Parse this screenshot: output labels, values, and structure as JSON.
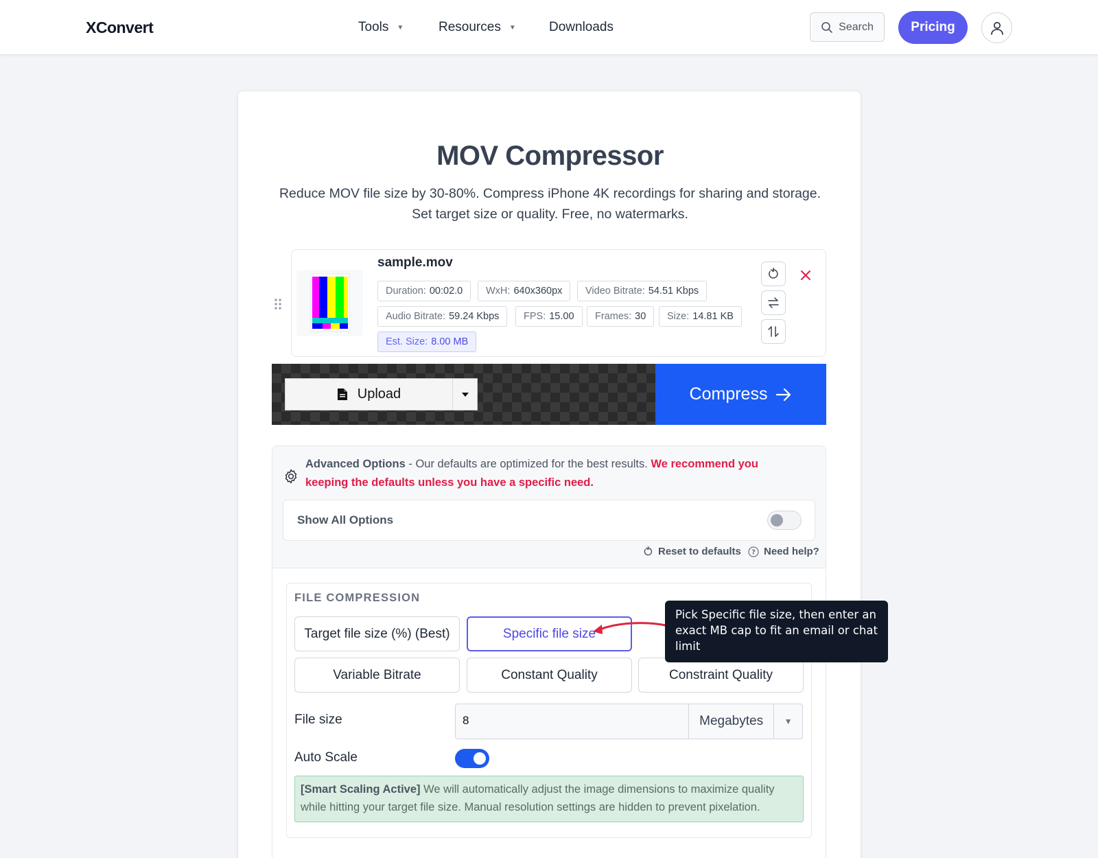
{
  "header": {
    "logo": "XConvert",
    "nav": [
      {
        "label": "Tools"
      },
      {
        "label": "Resources"
      },
      {
        "label": "Downloads"
      }
    ],
    "search_label": "Search",
    "pricing_label": "Pricing"
  },
  "page": {
    "title": "MOV Compressor",
    "subtitle_line1": "Reduce MOV file size by 30-80%. Compress iPhone 4K recordings for sharing and storage.",
    "subtitle_line2": "Set target size or quality. Free, no watermarks."
  },
  "file": {
    "name": "sample.mov",
    "meta": [
      {
        "label": "Duration:",
        "value": "00:02.0"
      },
      {
        "label": "WxH:",
        "value": "640x360px"
      },
      {
        "label": "Video Bitrate:",
        "value": "54.51 Kbps"
      },
      {
        "label": "Audio Bitrate:",
        "value": "59.24 Kbps"
      },
      {
        "label": "FPS:",
        "value": "15.00"
      },
      {
        "label": "Frames:",
        "value": "30"
      },
      {
        "label": "Size:",
        "value": "14.81 KB"
      }
    ],
    "est_label": "Est. Size:",
    "est_value": "8.00 MB"
  },
  "actions": {
    "upload_label": "Upload",
    "compress_label": "Compress"
  },
  "advanced": {
    "title": "Advanced Options",
    "desc": " - Our defaults are optimized for the best results. ",
    "warning": "We recommend you keeping the defaults unless you have a specific need.",
    "show_all_label": "Show All Options",
    "reset_label": "Reset to defaults",
    "help_label": "Need help?"
  },
  "compression": {
    "section_title": "FILE COMPRESSION",
    "modes": [
      {
        "label": "Target file size (%) (Best)"
      },
      {
        "label": "Specific file size"
      },
      {
        "label": "Variable Bitrate"
      },
      {
        "label": "Constant Quality"
      },
      {
        "label": "Constraint Quality"
      }
    ],
    "active_mode": "Specific file size",
    "file_size_label": "File size",
    "file_size_value": "8",
    "unit_value": "Megabytes",
    "auto_scale_label": "Auto Scale",
    "auto_scale_on": true,
    "smart_tag": "[Smart Scaling Active]",
    "smart_text": " We will automatically adjust the image dimensions to maximize quality while hitting your target file size. Manual resolution settings are hidden to prevent pixelation."
  },
  "tooltip": {
    "text": "Pick Specific file size, then enter an exact MB cap to fit an email or chat limit"
  },
  "colors": {
    "accent": "#5b5bf0",
    "compress_blue": "#1a5cf5",
    "warning_red": "#e11d48",
    "toggle_blue": "#1d5bf0",
    "smart_green": "#dbeee2"
  },
  "icons": [
    "search-icon",
    "user-icon",
    "drag-handle-icon",
    "reset-icon",
    "swap-horizontal-icon",
    "swap-vertical-icon",
    "close-icon",
    "file-icon",
    "caret-down-icon",
    "arrow-right-icon",
    "gear-icon",
    "question-icon"
  ]
}
